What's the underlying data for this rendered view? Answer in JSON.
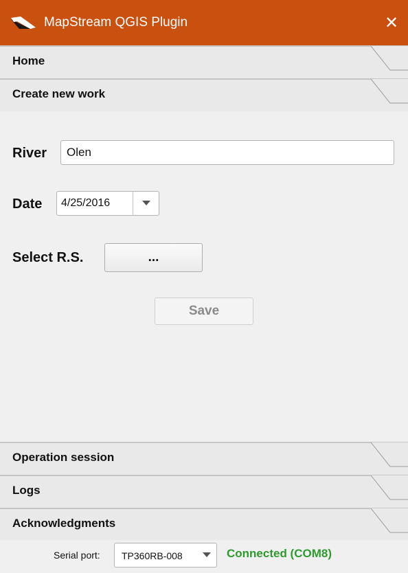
{
  "window": {
    "title": "MapStream QGIS Plugin",
    "close_glyph": "✕",
    "accent_color": "#ca5010"
  },
  "sections": {
    "home": "Home",
    "create_new_work": "Create new work",
    "operation_session": "Operation session",
    "logs": "Logs",
    "acknowledgments": "Acknowledgments"
  },
  "form": {
    "river_label": "River",
    "river_value": "Olen",
    "date_label": "Date",
    "date_value": "4/25/2016",
    "select_rs_label": "Select R.S.",
    "select_rs_button": "...",
    "save_button": "Save"
  },
  "footer": {
    "serial_port_label": "Serial port:",
    "serial_port_value": "TP360RB-008",
    "status_text": "Connected (COM8)",
    "status_color": "#2e9a2e"
  },
  "icons": {
    "app": "mapstream-logo-icon",
    "close": "close-icon",
    "dropdown": "chevron-down-icon"
  }
}
